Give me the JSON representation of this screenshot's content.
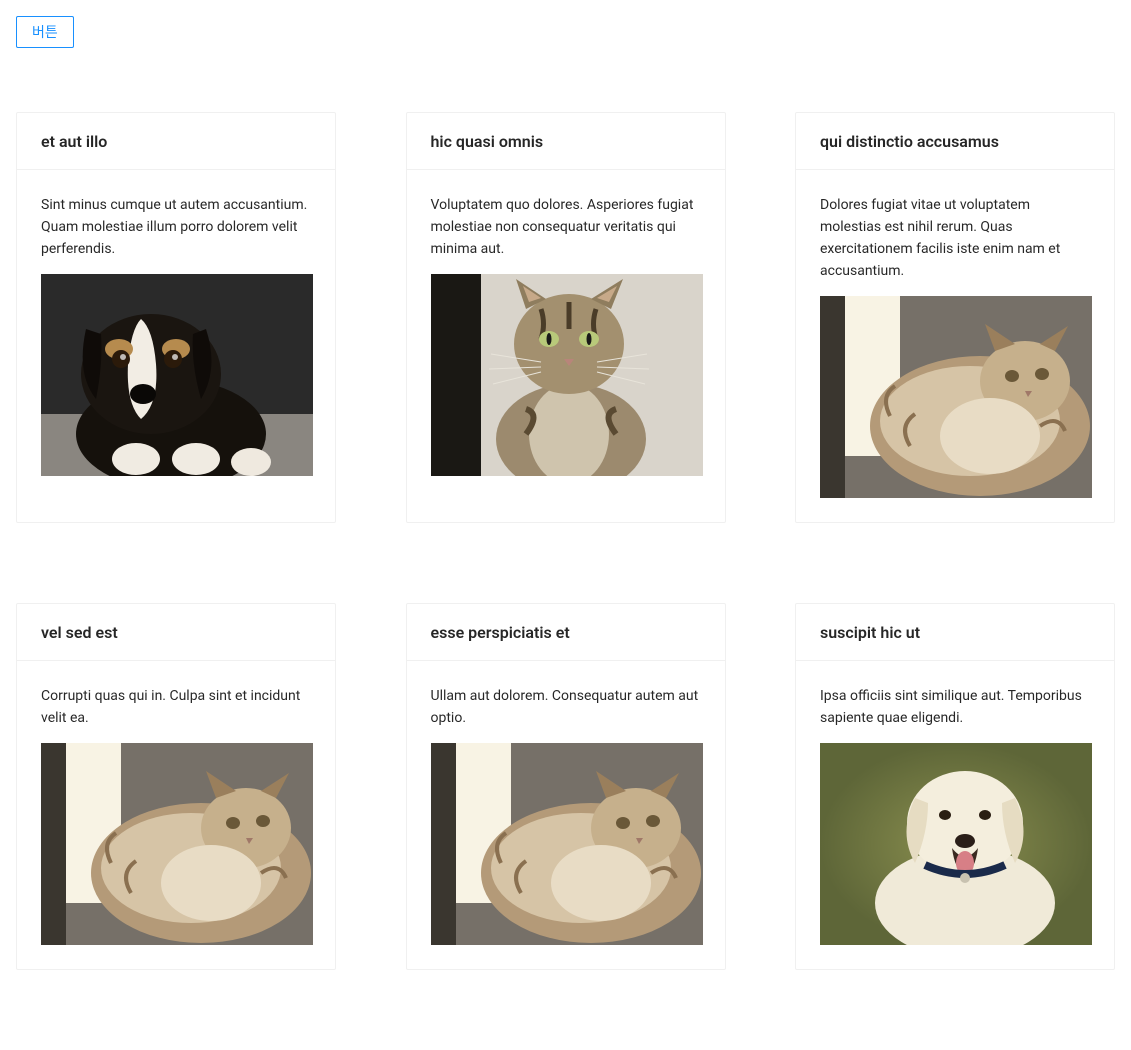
{
  "topButton": {
    "label": "버튼"
  },
  "cards": [
    {
      "title": "et aut illo",
      "description": "Sint minus cumque ut autem accusantium. Quam molestiae illum porro dolorem velit perferendis.",
      "imageKind": "puppy"
    },
    {
      "title": "hic quasi omnis",
      "description": "Voluptatem quo dolores. Asperiores fugiat molestiae non consequatur veritatis qui minima aut.",
      "imageKind": "tabby-cat"
    },
    {
      "title": "qui distinctio accusamus",
      "description": "Dolores fugiat vitae ut voluptatem molestias est nihil rerum. Quas exercitationem facilis iste enim nam et accusantium.",
      "imageKind": "fluffy-cat"
    },
    {
      "title": "vel sed est",
      "description": "Corrupti quas qui in. Culpa sint et incidunt velit ea.",
      "imageKind": "fluffy-cat"
    },
    {
      "title": "esse perspiciatis et",
      "description": "Ullam aut dolorem. Consequatur autem aut optio.",
      "imageKind": "fluffy-cat"
    },
    {
      "title": "suscipit hic ut",
      "description": "Ipsa officiis sint similique aut. Temporibus sapiente quae eligendi.",
      "imageKind": "white-dog"
    }
  ]
}
